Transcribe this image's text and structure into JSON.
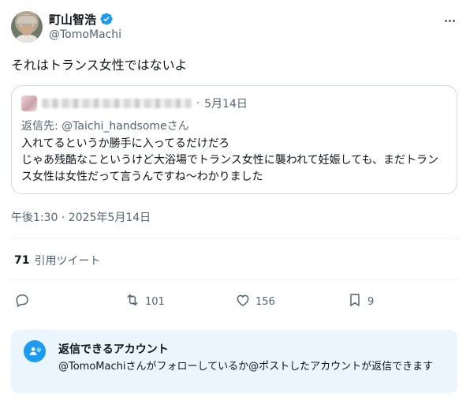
{
  "author": {
    "display_name": "町山智浩",
    "handle": "@TomoMachi",
    "verified": true
  },
  "tweet": {
    "text": "それはトランス女性ではないよ",
    "timestamp": "午後1:30 · 2025年5月14日"
  },
  "quoted_tweet": {
    "separator": "·",
    "date": "5月14日",
    "reply_to": "返信先: @Taichi_handsomeさん",
    "body": "入れてるというか勝手に入ってるだけだろ\nじゃあ残酷なこというけど大浴場でトランス女性に襲われて妊娠しても、まだトランス女性は女性だって言うんですね〜わかりました"
  },
  "stats": {
    "quotes_count": "71",
    "quotes_label": "引用ツイート"
  },
  "actions": {
    "retweets": "101",
    "likes": "156",
    "bookmarks": "9"
  },
  "reply_restriction": {
    "title": "返信できるアカウント",
    "description": "@TomoMachiさんがフォローしているか@ポストしたアカウントが返信できます"
  },
  "colors": {
    "accent": "#1d9bf0",
    "secondary_text": "#536471",
    "reply_box_bg": "#eaf5fd"
  },
  "icons": [
    "verified-badge-icon",
    "more-icon",
    "reply-icon",
    "retweet-icon",
    "like-icon",
    "bookmark-icon",
    "mention-person-icon"
  ]
}
